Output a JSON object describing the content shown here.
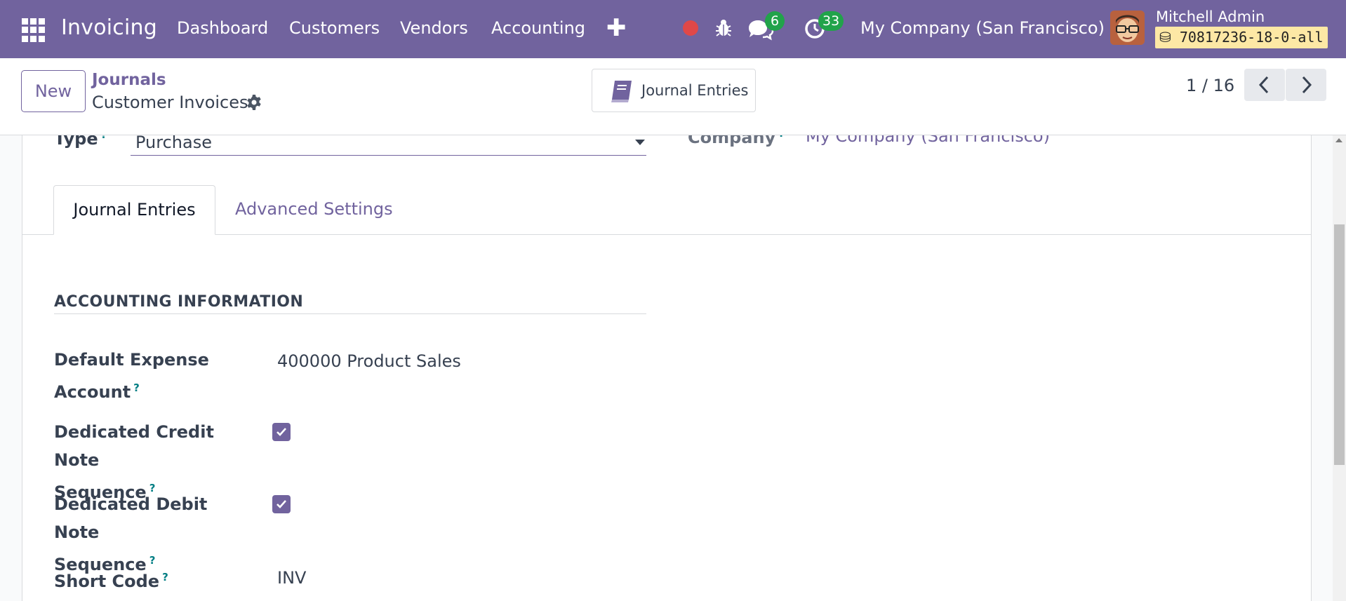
{
  "navbar": {
    "app_name": "Invoicing",
    "menu": [
      "Dashboard",
      "Customers",
      "Vendors",
      "Accounting"
    ],
    "messages_count": "6",
    "activities_count": "33",
    "company": "My Company (San Francisco)",
    "user_name": "Mitchell Admin",
    "database": "70817236-18-0-all",
    "colors": {
      "brand": "#71639e",
      "badge": "#21a34a",
      "record": "#e04848"
    }
  },
  "control_panel": {
    "new_label": "New",
    "breadcrumb_parent": "Journals",
    "breadcrumb_current": "Customer Invoices",
    "smart_button_label": "Journal Entries",
    "pager": "1 / 16"
  },
  "form": {
    "type_label": "Type",
    "type_value": "Purchase",
    "company_label": "Company",
    "company_value": "My Company (San Francisco)",
    "tabs": [
      "Journal Entries",
      "Advanced Settings"
    ],
    "section_title": "ACCOUNTING INFORMATION",
    "fields": {
      "default_expense_account": {
        "label_line1": "Default Expense",
        "label_line2": "Account",
        "value": "400000 Product Sales"
      },
      "credit_note_sequence": {
        "label_line1": "Dedicated Credit Note",
        "label_line2": "Sequence",
        "checked": true
      },
      "debit_note_sequence": {
        "label_line1": "Dedicated Debit Note",
        "label_line2": "Sequence",
        "checked": true
      },
      "short_code": {
        "label": "Short Code",
        "value": "INV"
      }
    },
    "help_marker": "?"
  }
}
